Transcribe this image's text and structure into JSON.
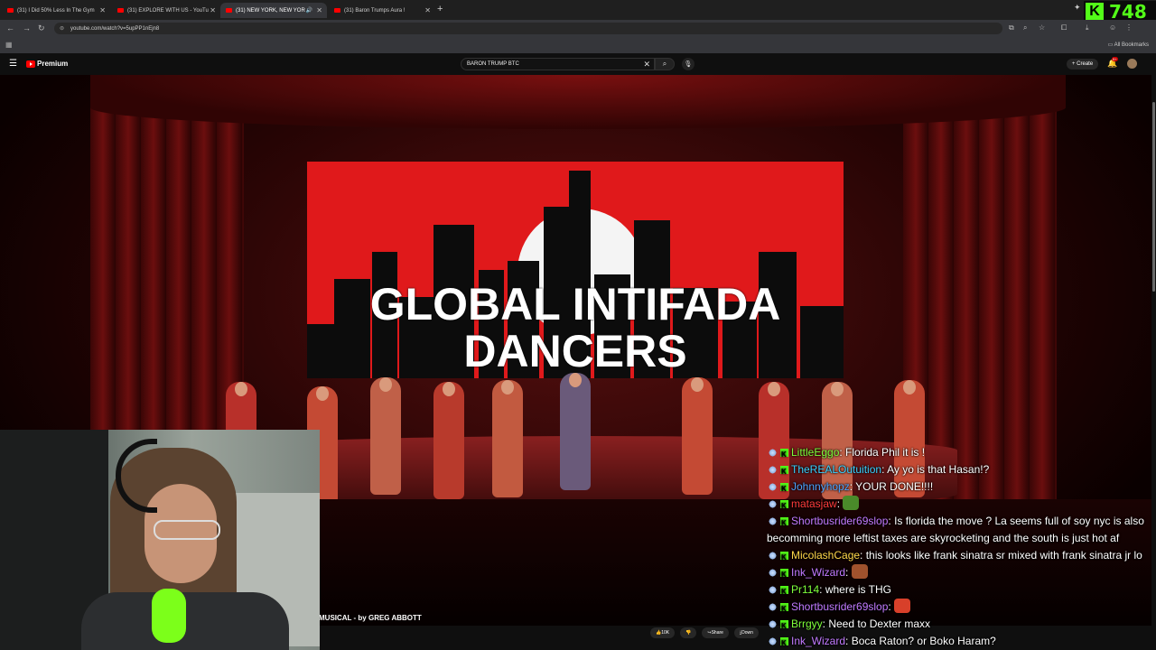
{
  "browser": {
    "tabs": [
      {
        "label": "(31) I Did 50% Less In The Gym",
        "active": false
      },
      {
        "label": "(31) EXPLORE WITH US - YouTu",
        "active": false
      },
      {
        "label": "(31) NEW YORK, NEW YOR",
        "active": true
      },
      {
        "label": "(31) Baron Trumps Aura !",
        "active": false
      }
    ],
    "url": "youtube.com/watch?v=5upPP1nEjn8",
    "bookmarks_label": "All Bookmarks",
    "viewer_count": "748"
  },
  "youtube": {
    "brand": "Premium",
    "search_value": "BARON TRUMP BTC",
    "create_label": "+ Create",
    "notification_count": "9+"
  },
  "video": {
    "screen_title_line1": "GLOBAL INTIFADA",
    "screen_title_line2": "DANCERS",
    "caption": "MUSICAL - by GREG ABBOTT",
    "like_count": "10K",
    "share_label": "Share",
    "download_label": "Down"
  },
  "chat": [
    {
      "user": "LittleEggo",
      "color": "#7fff3a",
      "text": "Florida Phil it is !"
    },
    {
      "user": "TheREALOutuition",
      "color": "#3ad1ff",
      "text": "Ay yo is that Hasan!?"
    },
    {
      "user": "Johnnyhopz",
      "color": "#4da3ff",
      "text": "YOUR DONE!!!!"
    },
    {
      "user": "matasjaw",
      "color": "#ff3b3b",
      "text": "",
      "emote": "#4a8a2a"
    },
    {
      "user": "Shortbusrider69slop",
      "color": "#c27aff",
      "text": "Is florida the move ? La seems full of soy nyc is also becomming more leftist taxes are skyrocketing and the south is just hot af",
      "wrap": true
    },
    {
      "user": "MicolashCage",
      "color": "#ffd84a",
      "text": "this looks like frank sinatra sr mixed with frank sinatra jr lo"
    },
    {
      "user": "Ink_Wizard",
      "color": "#c27aff",
      "text": "",
      "emote": "#a0522d"
    },
    {
      "user": "Pr114",
      "color": "#7fff3a",
      "text": "where is THG"
    },
    {
      "user": "Shortbusrider69slop",
      "color": "#c27aff",
      "text": "",
      "emote": "#d8402a"
    },
    {
      "user": "Brrgyy",
      "color": "#7fff3a",
      "text": "Need to Dexter maxx"
    },
    {
      "user": "Ink_Wizard",
      "color": "#c27aff",
      "text": "Boca Raton? or Boko Haram?"
    }
  ]
}
